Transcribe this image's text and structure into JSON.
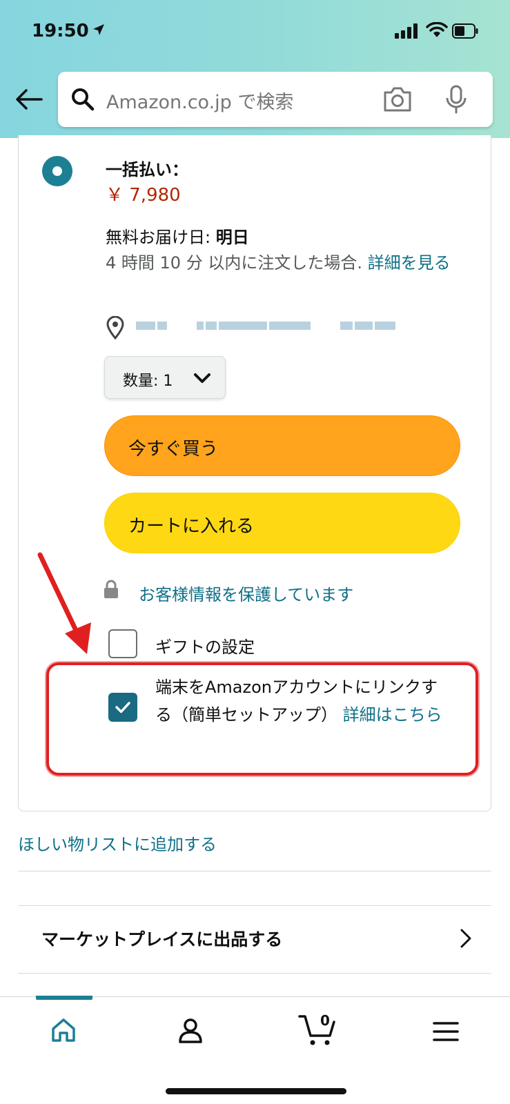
{
  "status_bar": {
    "time": "19:50"
  },
  "search": {
    "placeholder": "Amazon.co.jp で検索"
  },
  "purchase": {
    "payment_label": "一括払い：",
    "price": "￥ 7,980",
    "delivery_prefix": "無料お届け日: ",
    "delivery_day": "明日",
    "delivery_note": "4 時間 10 分 以内に注文した場合. ",
    "delivery_link": "詳細を見る",
    "quantity_label": "数量: 1",
    "buy_now_label": "今すぐ買う",
    "add_to_cart_label": "カートに入れる",
    "secure_text": "お客様情報を保護しています",
    "gift_label": "ギフトの設定",
    "link_device_text": "端末をAmazonアカウントにリンクする（簡単セットアップ）",
    "link_device_link": "詳細はこちら"
  },
  "wishlist_label": "ほしい物リストに追加する",
  "marketplace_label": "マーケットプレイスに出品する",
  "bottom_nav": {
    "cart_count": "0"
  },
  "colors": {
    "accent": "#1d7f94",
    "price": "#b12704",
    "buy_now": "#ffa41c",
    "add_to_cart": "#ffd814",
    "highlight": "#e02020"
  }
}
